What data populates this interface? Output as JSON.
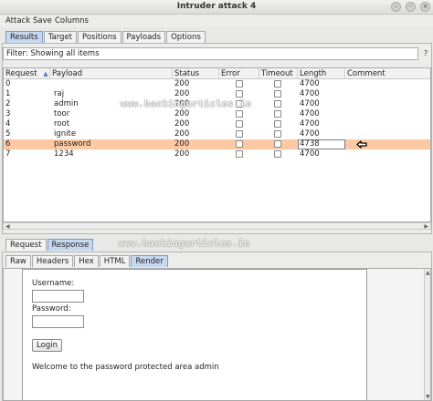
{
  "window": {
    "title": "Intruder attack 4"
  },
  "menu": [
    "Attack",
    "Save",
    "Columns"
  ],
  "top_tabs": [
    {
      "label": "Results",
      "active": true
    },
    {
      "label": "Target",
      "active": false
    },
    {
      "label": "Positions",
      "active": false
    },
    {
      "label": "Payloads",
      "active": false
    },
    {
      "label": "Options",
      "active": false
    }
  ],
  "filter": {
    "text": "Filter: Showing all items",
    "help": "?"
  },
  "table": {
    "columns": [
      "Request",
      "Payload",
      "Status",
      "Error",
      "Timeout",
      "Length",
      "Comment"
    ],
    "sort_indicator": "▲",
    "rows": [
      {
        "request": "0",
        "payload": "",
        "status": "200",
        "length": "4700",
        "selected": false
      },
      {
        "request": "1",
        "payload": "raj",
        "status": "200",
        "length": "4700",
        "selected": false
      },
      {
        "request": "2",
        "payload": "admin",
        "status": "200",
        "length": "4700",
        "selected": false
      },
      {
        "request": "3",
        "payload": "toor",
        "status": "200",
        "length": "4700",
        "selected": false
      },
      {
        "request": "4",
        "payload": "root",
        "status": "200",
        "length": "4700",
        "selected": false
      },
      {
        "request": "5",
        "payload": "ignite",
        "status": "200",
        "length": "4700",
        "selected": false
      },
      {
        "request": "6",
        "payload": "password",
        "status": "200",
        "length": "4738",
        "selected": true
      },
      {
        "request": "7",
        "payload": "1234",
        "status": "200",
        "length": "4700",
        "selected": false
      }
    ]
  },
  "watermark": "www.hackingarticles.in",
  "req_resp_tabs": [
    {
      "label": "Request",
      "active": false
    },
    {
      "label": "Response",
      "active": true
    }
  ],
  "view_tabs": [
    {
      "label": "Raw",
      "active": false
    },
    {
      "label": "Headers",
      "active": false
    },
    {
      "label": "Hex",
      "active": false
    },
    {
      "label": "HTML",
      "active": false
    },
    {
      "label": "Render",
      "active": true
    }
  ],
  "render": {
    "username_label": "Username:",
    "password_label": "Password:",
    "login_button": "Login",
    "message": "Welcome to the password protected area admin"
  },
  "colors": {
    "selected_row": "#fcc9a4",
    "active_tab": "#c6d8ee"
  }
}
